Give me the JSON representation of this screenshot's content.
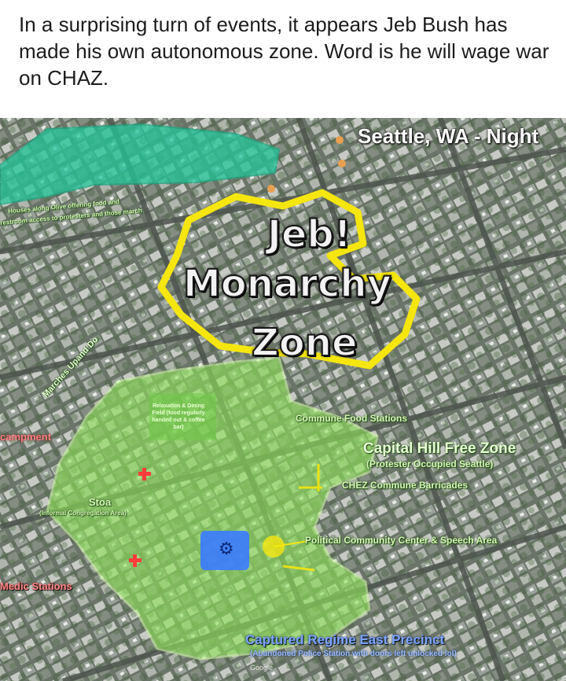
{
  "caption": "In a surprising turn of events, it appears Jeb Bush has made his own autonomous zone. Word is he will wage war on CHAZ.",
  "map": {
    "city_label": "Seattle, WA - Night",
    "monarchy_zone": {
      "line1": "Jeb!",
      "line2": "Monarchy",
      "line3": "Zone"
    },
    "free_zone_title": "Capital Hill Free Zone",
    "free_zone_subtitle": "(Protester Occupied Seattle)",
    "food_stations": "Commune Food Stations",
    "barricades": "CHEZ Commune Barricades",
    "political_center": "Political Community Center & Speech Area",
    "precinct_title": "Captured Regime East Precinct",
    "precinct_subtitle": "(Abandoned Police Station with doors left unlocked lol)",
    "medic_stations": "Medic Stations",
    "stoa": "Stoa",
    "stoa_subtitle": "(Informal Congregation Area)",
    "encampment": "campment",
    "marches": "Marches Upand Do",
    "houses_line1": "Houses along Olive offering food and",
    "houses_line2": "restroom access to protesters and those march",
    "relaxation": "Relaxation & Dining Field (food regularly handed out & coffee bar)",
    "watermark": "Google",
    "colors": {
      "monarchy_outline": "#f5e60f",
      "free_zone_fill": "#8fe35a",
      "northern_zone_fill": "#22c79a",
      "precinct_blue": "#3a7bff",
      "medic_red": "#ff3b3b"
    }
  }
}
